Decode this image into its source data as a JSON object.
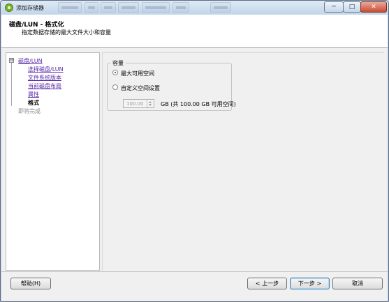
{
  "window": {
    "title": "添加存储器",
    "controls": {
      "minimize": "─",
      "maximize": "□",
      "close": "✕"
    }
  },
  "header": {
    "title": "磁盘/LUN - 格式化",
    "subtitle": "指定数据存储的最大文件大小和容量"
  },
  "nav": {
    "collapse_symbol": "⊟",
    "items": [
      {
        "label": "磁盘/LUN",
        "state": "link"
      },
      {
        "label": "选择磁盘/LUN",
        "state": "link"
      },
      {
        "label": "文件系统版本",
        "state": "link"
      },
      {
        "label": "当前磁盘布局",
        "state": "link"
      },
      {
        "label": "属性",
        "state": "link"
      },
      {
        "label": "格式",
        "state": "current"
      },
      {
        "label": "即将完成",
        "state": "pending"
      }
    ]
  },
  "capacity": {
    "group_label": "容量",
    "option_max": "最大可用空间",
    "option_custom": "自定义空间设置",
    "selected": "option_max",
    "custom_value": "100.00",
    "custom_unit": "GB (共 100.00 GB 可用空间)"
  },
  "footer": {
    "help": "帮助(H)",
    "back": "< 上一步",
    "next": "下一步 >",
    "cancel": "取消"
  },
  "colors": {
    "link": "#5a2aa8",
    "accent": "#3c7fb1"
  }
}
